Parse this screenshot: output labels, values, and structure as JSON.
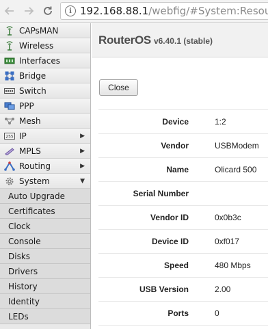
{
  "browser": {
    "url_host": "192.168.88.1",
    "url_path": "/webfig/#System:Resources."
  },
  "sidebar": {
    "items": [
      {
        "label": "CAPsMAN",
        "icon": "antenna-icon"
      },
      {
        "label": "Wireless",
        "icon": "antenna-icon"
      },
      {
        "label": "Interfaces",
        "icon": "network-card-icon"
      },
      {
        "label": "Bridge",
        "icon": "bridge-icon"
      },
      {
        "label": "Switch",
        "icon": "switch-icon"
      },
      {
        "label": "PPP",
        "icon": "ppp-icon"
      },
      {
        "label": "Mesh",
        "icon": "mesh-icon"
      },
      {
        "label": "IP",
        "icon": "ip-icon",
        "arrow": "▶"
      },
      {
        "label": "MPLS",
        "icon": "mpls-icon",
        "arrow": "▶"
      },
      {
        "label": "Routing",
        "icon": "routing-icon",
        "arrow": "▶"
      },
      {
        "label": "System",
        "icon": "gear-icon",
        "arrow": "▼"
      }
    ],
    "system_submenu": [
      "Auto Upgrade",
      "Certificates",
      "Clock",
      "Console",
      "Disks",
      "Drivers",
      "History",
      "Identity",
      "LEDs"
    ]
  },
  "header": {
    "brand": "RouterOS",
    "version": "v6.40.1 (stable)"
  },
  "close_label": "Close",
  "properties": [
    {
      "label": "Device",
      "value": "1:2"
    },
    {
      "label": "Vendor",
      "value": "USBModem"
    },
    {
      "label": "Name",
      "value": "Olicard 500"
    },
    {
      "label": "Serial Number",
      "value": ""
    },
    {
      "label": "Vendor ID",
      "value": "0x0b3c"
    },
    {
      "label": "Device ID",
      "value": "0xf017"
    },
    {
      "label": "Speed",
      "value": "480 Mbps"
    },
    {
      "label": "USB Version",
      "value": "2.00"
    },
    {
      "label": "Ports",
      "value": "0"
    }
  ]
}
